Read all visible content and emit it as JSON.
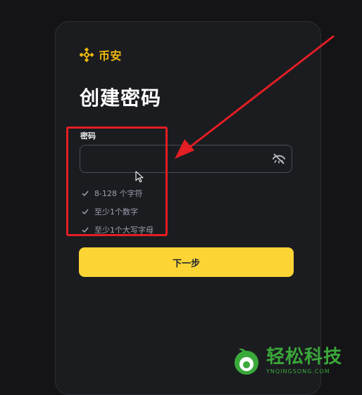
{
  "brand": {
    "name": "币安"
  },
  "page": {
    "title": "创建密码"
  },
  "form": {
    "password_label": "密码",
    "password_value": "",
    "next_label": "下一步"
  },
  "requirements": [
    {
      "text": "8-128 个字符",
      "met": true
    },
    {
      "text": "至少1个数字",
      "met": true
    },
    {
      "text": "至少1个大写字母",
      "met": true
    }
  ],
  "watermark": {
    "text": "轻松科技",
    "subtext": "YNQINGSONG.COM"
  },
  "colors": {
    "accent": "#fcd535",
    "brand": "#f0b90b",
    "annotation": "#e31e24",
    "watermark": "#3aa83a"
  }
}
